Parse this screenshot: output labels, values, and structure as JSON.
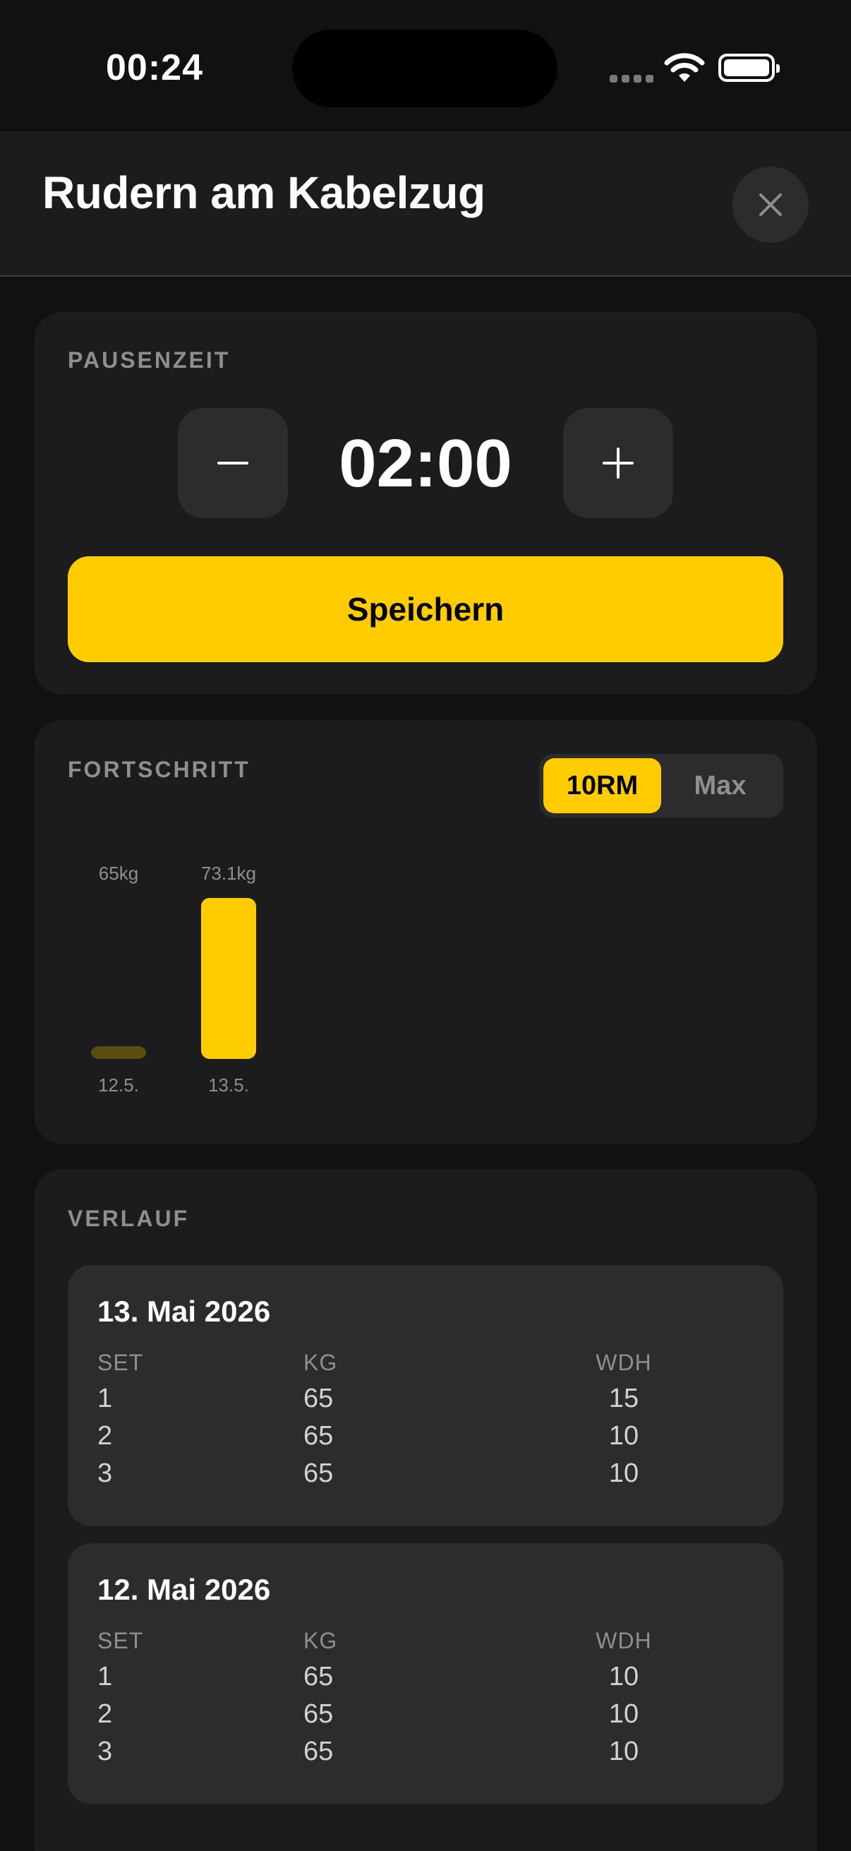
{
  "status_bar": {
    "time": "00:24"
  },
  "header": {
    "title": "Rudern am Kabelzug"
  },
  "pause": {
    "label": "PAUSENZEIT",
    "value": "02:00",
    "save_label": "Speichern"
  },
  "progress": {
    "label": "FORTSCHRITT",
    "toggle": [
      "10RM",
      "Max"
    ],
    "active_toggle": "10RM"
  },
  "chart_data": {
    "type": "bar",
    "categories": [
      "12.5.",
      "13.5."
    ],
    "values": [
      65,
      73.1
    ],
    "value_labels": [
      "65kg",
      "73.1kg"
    ],
    "unit": "kg",
    "bar_colors": [
      "#5c4d10",
      "#ffcc00"
    ],
    "title": "",
    "xlabel": "",
    "ylabel": "",
    "grid": false
  },
  "history": {
    "label": "VERLAUF",
    "columns": [
      "SET",
      "KG",
      "WDH"
    ],
    "entries": [
      {
        "date": "13. Mai 2026",
        "rows": [
          {
            "set": "1",
            "kg": "65",
            "wdh": "15"
          },
          {
            "set": "2",
            "kg": "65",
            "wdh": "10"
          },
          {
            "set": "3",
            "kg": "65",
            "wdh": "10"
          }
        ]
      },
      {
        "date": "12. Mai 2026",
        "rows": [
          {
            "set": "1",
            "kg": "65",
            "wdh": "10"
          },
          {
            "set": "2",
            "kg": "65",
            "wdh": "10"
          },
          {
            "set": "3",
            "kg": "65",
            "wdh": "10"
          }
        ]
      }
    ]
  },
  "colors": {
    "accent": "#ffcc00",
    "background": "#111112",
    "card": "#1c1c1e",
    "inner": "#2c2c2e",
    "muted": "#8e8e93"
  }
}
